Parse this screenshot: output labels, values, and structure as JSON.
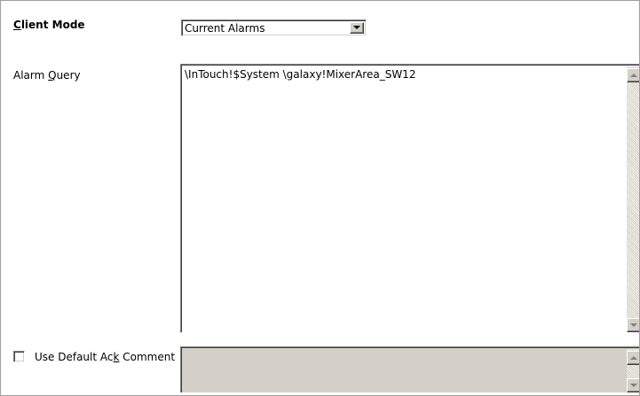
{
  "client_mode": {
    "label_prefix": "",
    "label_accel": "C",
    "label_rest": "lient Mode",
    "selected_value": "Current Alarms"
  },
  "alarm_query": {
    "label_prefix": "Alarm ",
    "label_accel": "Q",
    "label_rest": "uery",
    "value": "\\InTouch!$System \\galaxy!MixerArea_SW12"
  },
  "ack_comment": {
    "label_prefix": "Use Default Ac",
    "label_accel": "k",
    "label_rest": " Comment",
    "checked": false,
    "value": ""
  },
  "icons": {
    "dropdown": "chevron-down-icon",
    "scroll_up": "scroll-up-arrow-icon",
    "scroll_down": "scroll-down-arrow-icon"
  },
  "colors": {
    "control_face": "#d4d0c8",
    "shadow": "#808080",
    "dark_shadow": "#404040",
    "highlight": "#ffffff",
    "border": "#a0a0a0"
  }
}
